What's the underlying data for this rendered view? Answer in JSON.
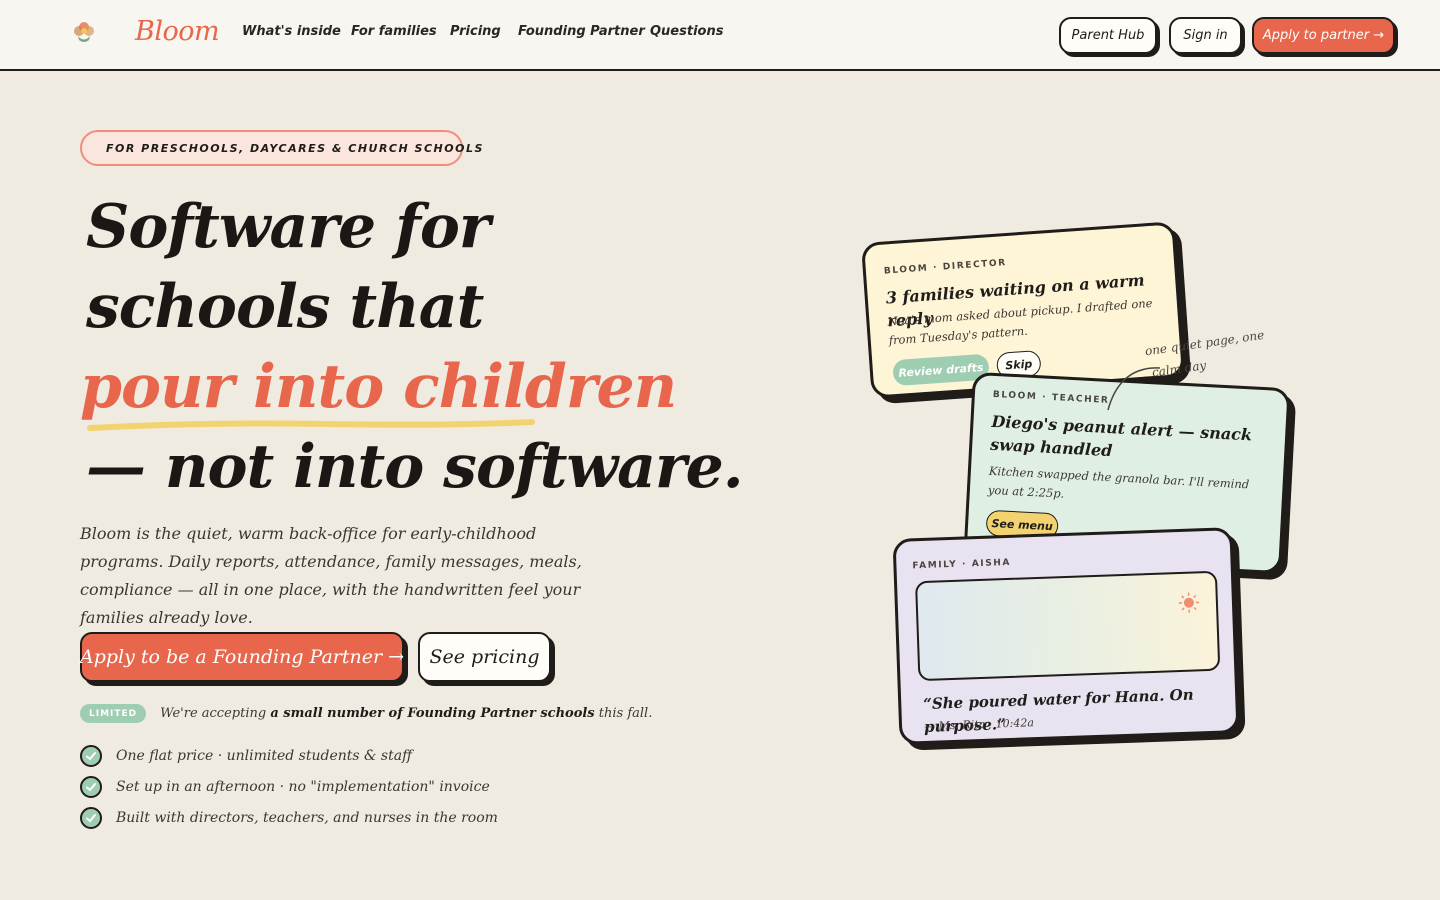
{
  "brand": {
    "name": "Bloom",
    "logo_icon": "flower-logo-icon",
    "accent_color": "#e8674c"
  },
  "nav": {
    "links": [
      "What's inside",
      "For families",
      "Pricing",
      "Founding Partner",
      "Questions"
    ],
    "parent_hub": "Parent Hub",
    "sign_in": "Sign in",
    "apply": "Apply to partner →"
  },
  "hero": {
    "eyebrow": "FOR PRESCHOOLS, DAYCARES & CHURCH SCHOOLS",
    "headline": {
      "line1": "Software for",
      "line2": "schools that",
      "line3": "pour into children",
      "line4": "— not into software."
    },
    "lede": "Bloom is the quiet, warm back-office for early-childhood programs. Daily reports, attendance, family messages, meals, compliance — all in one place, with the handwritten feel your families already love.",
    "cta_primary": "Apply to be a Founding Partner →",
    "cta_secondary": "See pricing",
    "limited": {
      "badge": "LIMITED",
      "text_before": "We're accepting ",
      "text_bold": "a small number of Founding Partner schools",
      "text_after": " this fall."
    },
    "checks": [
      "One flat price · unlimited students & staff",
      "Set up in an afternoon · no \"implementation\" invoice",
      "Built with directors, teachers, and nurses in the room"
    ]
  },
  "cards": {
    "director": {
      "tag": "BLOOM · DIRECTOR",
      "title": "3 families waiting on a warm reply",
      "body": "Noa's mom asked about pickup. I drafted one from Tuesday's pattern.",
      "primary": "Review drafts",
      "secondary": "Skip",
      "color": "#fdf5d6"
    },
    "teacher": {
      "tag": "BLOOM · TEACHER",
      "title": "Diego's peanut alert — snack swap handled",
      "body": "Kitchen swapped the granola bar. I'll remind you at 2:25p.",
      "action": "See menu",
      "color": "#e0efe4"
    },
    "family": {
      "tag": "FAMILY · AISHA",
      "photo_icon": "sun-icon",
      "quote": "“She poured water for Hana. On purpose.”",
      "byline": "— Ms. Rita · 10:42a",
      "color": "#e9e3f1"
    },
    "note": {
      "line1": "one quiet page, one",
      "line2": "calm day"
    }
  }
}
